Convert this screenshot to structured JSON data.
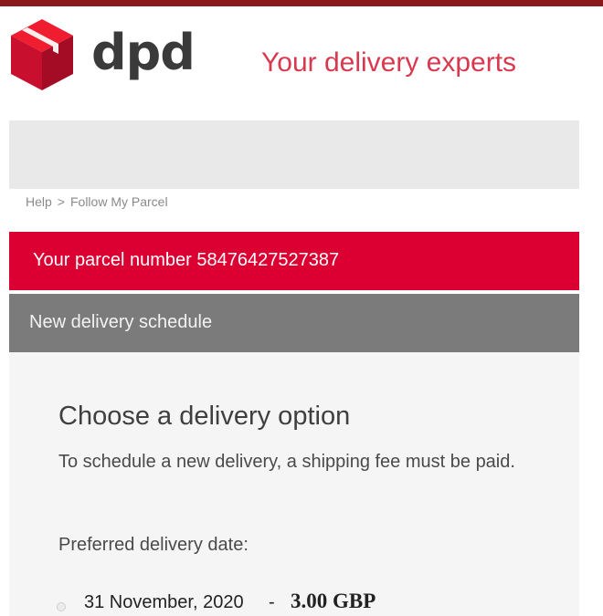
{
  "header": {
    "logo_text": "dpd",
    "tagline": "Your delivery experts"
  },
  "breadcrumb": {
    "items": [
      "Help",
      "Follow My Parcel"
    ],
    "separator": ">"
  },
  "parcel_bar": {
    "prefix": "Your parcel number",
    "number": "58476427527387"
  },
  "section_header": {
    "title": "New delivery schedule"
  },
  "content": {
    "title": "Choose a delivery option",
    "description": "To schedule a new delivery, a shipping fee must be paid.",
    "date_label": "Preferred delivery date:",
    "options": [
      {
        "date": "31 November, 2020",
        "separator": "-",
        "price": "3.00 GBP"
      }
    ]
  },
  "colors": {
    "top_strip": "#8b1a1a",
    "brand_red": "#dc0032",
    "tagline_red": "#d8394f",
    "section_grey": "#7b7b7b",
    "search_bar_grey": "#e9e9e9"
  },
  "icons": {
    "logo": "dpd-cube-logo-icon",
    "radio": "radio-button-icon"
  }
}
